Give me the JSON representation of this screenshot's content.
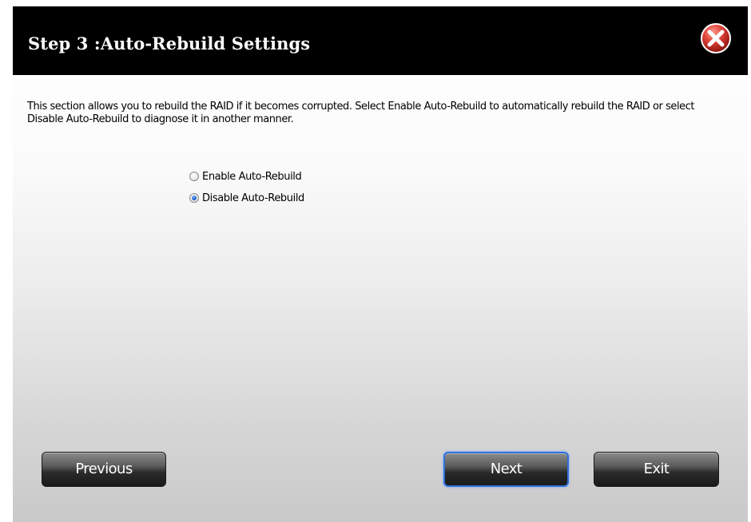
{
  "dialog": {
    "title": "Step 3 :Auto-Rebuild Settings",
    "close_icon": "close-icon",
    "description": "This section allows you to rebuild the RAID if it becomes corrupted. Select Enable Auto-Rebuild to automatically rebuild the RAID or select Disable Auto-Rebuild to diagnose it in another manner.",
    "options": [
      {
        "label": "Enable Auto-Rebuild",
        "selected": false
      },
      {
        "label": "Disable Auto-Rebuild",
        "selected": true
      }
    ],
    "buttons": {
      "previous_label": "Previous",
      "next_label": "Next",
      "exit_label": "Exit"
    }
  },
  "colors": {
    "titlebar": "#000000",
    "title_text": "#ffffff",
    "close_button": "#c9302c",
    "focus_border": "#2f6fd9"
  }
}
